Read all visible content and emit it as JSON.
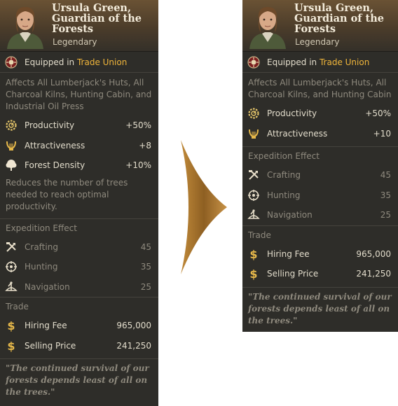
{
  "specialist": {
    "name": "Ursula Green, Guardian of the Forests",
    "rarity": "Legendary",
    "equipped_prefix": "Equipped in",
    "equipped_location": "Trade Union",
    "quote": "\"The continued survival of our forests depends least of all on the trees.\""
  },
  "left": {
    "description": "Affects All Lumberjack's Huts, All Charcoal Kilns, Hunting Cabin, and Industrial Oil Press",
    "effects": [
      {
        "icon": "productivity-gear-icon",
        "label": "Productivity",
        "value": "+50%"
      },
      {
        "icon": "attractiveness-lyre-icon",
        "label": "Attractiveness",
        "value": "+8"
      },
      {
        "icon": "tree-icon",
        "label": "Forest Density",
        "value": "+10%"
      }
    ],
    "forest_note": "Reduces the number of trees needed to reach optimal productivity."
  },
  "right": {
    "description": "Affects All Lumberjack's Huts, All Charcoal Kilns, and Hunting Cabin",
    "effects": [
      {
        "icon": "productivity-gear-icon",
        "label": "Productivity",
        "value": "+50%"
      },
      {
        "icon": "attractiveness-lyre-icon",
        "label": "Attractiveness",
        "value": "+10"
      }
    ]
  },
  "expedition": {
    "title": "Expedition Effect",
    "items": [
      {
        "icon": "crafting-tools-icon",
        "label": "Crafting",
        "value": "45"
      },
      {
        "icon": "hunting-crosshair-icon",
        "label": "Hunting",
        "value": "35"
      },
      {
        "icon": "navigation-sextant-icon",
        "label": "Navigation",
        "value": "25"
      }
    ]
  },
  "trade": {
    "title": "Trade",
    "items": [
      {
        "icon": "dollar-icon",
        "label": "Hiring Fee",
        "value": "965,000"
      },
      {
        "icon": "dollar-icon",
        "label": "Selling Price",
        "value": "241,250"
      }
    ]
  },
  "colors": {
    "panel_bg": "#2e2d29",
    "header_brown": "#6a5234",
    "highlight": "#f0b53a",
    "dim_text": "#8f8a7e",
    "arrow": "#a5722c"
  }
}
